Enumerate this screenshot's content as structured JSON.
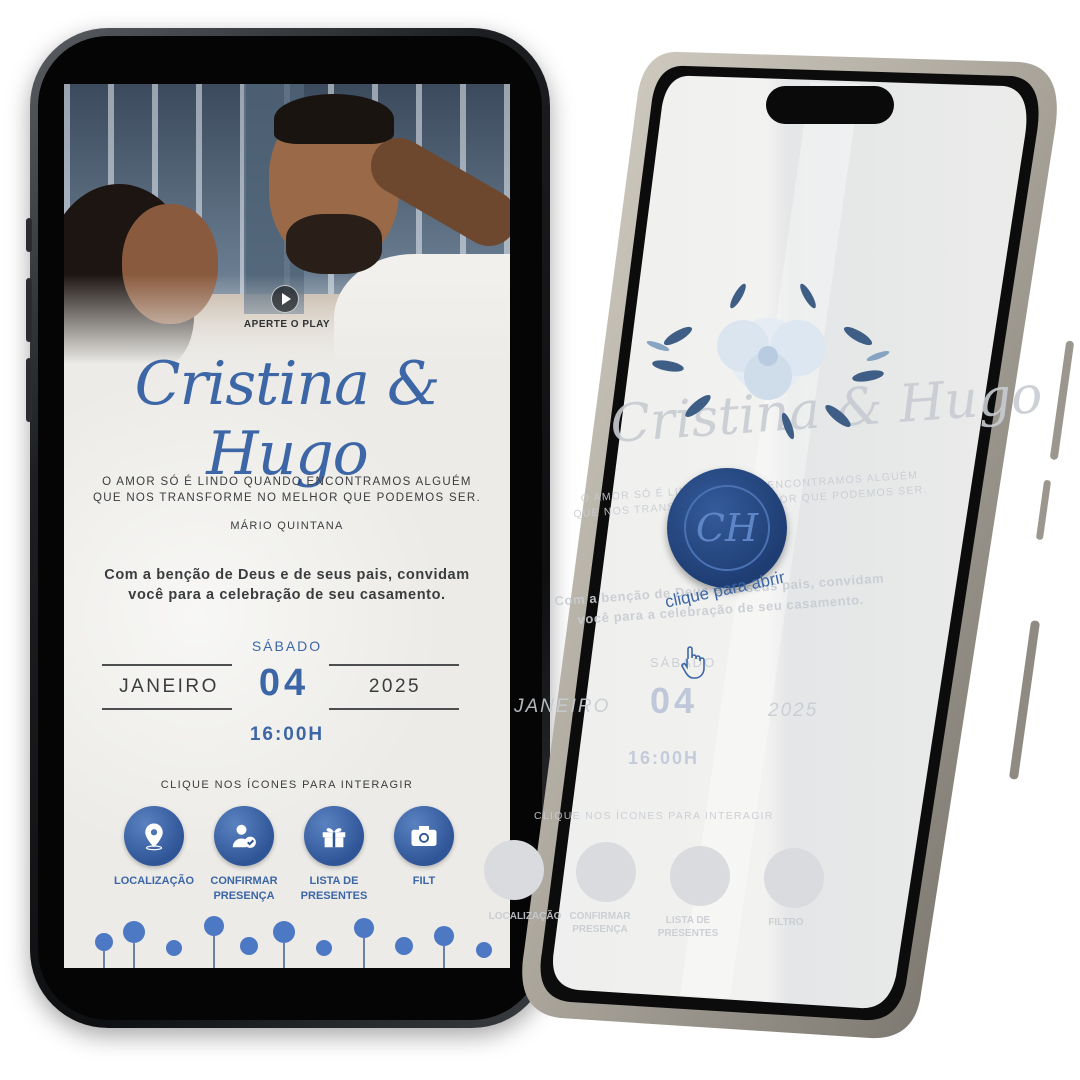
{
  "left_screen": {
    "play_label": "APERTE O PLAY",
    "names": "Cristina & Hugo",
    "quote_line1": "O AMOR SÓ É LINDO QUANDO ENCONTRAMOS ALGUÉM",
    "quote_line2": "QUE NOS TRANSFORME NO MELHOR QUE PODEMOS SER.",
    "author": "MÁRIO QUINTANA",
    "blessing_line1": "Com a benção de Deus e de seus pais, convidam",
    "blessing_line2": "você para a celebração de seu casamento.",
    "weekday": "SÁBADO",
    "month": "JANEIRO",
    "day": "04",
    "year": "2025",
    "time": "16:00H",
    "hint": "CLIQUE NOS ÍCONES PARA INTERAGIR",
    "actions": [
      {
        "label_line1": "LOCALIZAÇÃO",
        "label_line2": "",
        "icon": "location-pin-icon"
      },
      {
        "label_line1": "CONFIRMAR",
        "label_line2": "PRESENÇA",
        "icon": "user-check-icon"
      },
      {
        "label_line1": "LISTA DE",
        "label_line2": "PRESENTES",
        "icon": "gift-icon"
      },
      {
        "label_line1": "FILT",
        "label_line2": "",
        "icon": "camera-icon"
      }
    ]
  },
  "right_screen": {
    "seal_monogram": "CH",
    "seal_text": "clique para abrir",
    "faded_names": "Cristina & Hugo",
    "faded_quote_line1": "O AMOR SÓ É LINDO QUANDO ENCONTRAMOS ALGUÉM",
    "faded_quote_line2": "QUE NOS TRANSFORME NO MELHOR QUE PODEMOS SER.",
    "faded_blessing_line1": "Com a benção de Deus e de seus pais, convidam",
    "faded_blessing_line2": "você para a celebração de seu casamento.",
    "faded_weekday": "SÁBADO",
    "faded_month": "JANEIRO",
    "faded_day": "04",
    "faded_year": "2025",
    "faded_time": "16:00H",
    "faded_hint": "CLIQUE NOS ÍCONES PARA INTERAGIR",
    "faded_actions": [
      {
        "label_line1": "LOCALIZAÇÃO",
        "label_line2": ""
      },
      {
        "label_line1": "CONFIRMAR",
        "label_line2": "PRESENÇA"
      },
      {
        "label_line1": "LISTA DE",
        "label_line2": "PRESENTES"
      },
      {
        "label_line1": "FILTRO",
        "label_line2": ""
      }
    ]
  },
  "colors": {
    "accent_blue": "#3c66a6",
    "seal_blue": "#1e3d73",
    "paper": "#ecebe7",
    "text_dark": "#3a3c3e"
  }
}
